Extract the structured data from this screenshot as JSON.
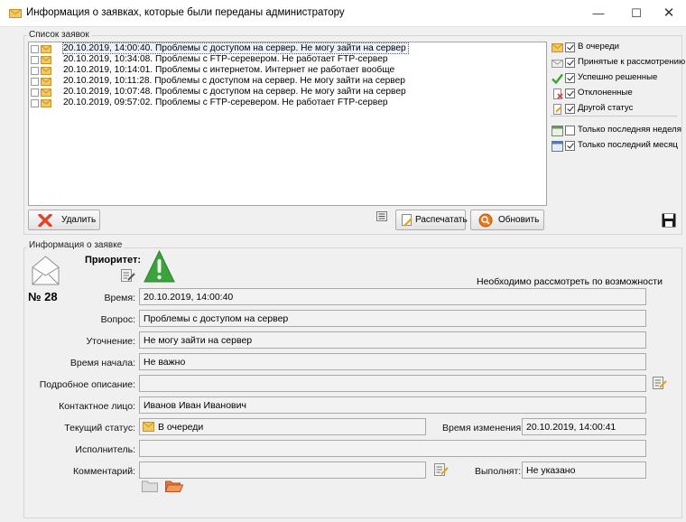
{
  "window": {
    "title": "Информация о заявках, которые были переданы администратору",
    "minimize_glyph": "—",
    "maximize_glyph": "☐",
    "close_glyph": "✕"
  },
  "list_group": {
    "title": "Список заявок",
    "requests": [
      {
        "text": "20.10.2019, 14:00:40. Проблемы с доступом на сервер. Не могу зайти на сервер",
        "checked": false,
        "selected": true
      },
      {
        "text": "20.10.2019, 10:34:08. Проблемы с FTP-серевером. Не работает FTP-сервер",
        "checked": false,
        "selected": false
      },
      {
        "text": "20.10.2019, 10:14:01. Проблемы с интернетом. Интернет не работает вообще",
        "checked": false,
        "selected": false
      },
      {
        "text": "20.10.2019, 10:11:28. Проблемы с доступом на сервер. Не могу зайти на сервер",
        "checked": false,
        "selected": false
      },
      {
        "text": "20.10.2019, 10:07:48. Проблемы с доступом на сервер. Не могу зайти на сервер",
        "checked": false,
        "selected": false
      },
      {
        "text": "20.10.2019, 09:57:02. Проблемы с FTP-серевером. Не работает FTP-сервер",
        "checked": false,
        "selected": false
      }
    ],
    "filters": [
      {
        "label": "В очереди",
        "checked": true,
        "icon": "envelope-icon"
      },
      {
        "label": "Принятые к рассмотрению",
        "checked": true,
        "icon": "envelope-open-icon"
      },
      {
        "label": "Успешно решенные",
        "checked": true,
        "icon": "checkmark-icon"
      },
      {
        "label": "Отклоненные",
        "checked": true,
        "icon": "rejected-doc-icon"
      },
      {
        "label": "Другой статус",
        "checked": true,
        "icon": "other-doc-icon"
      }
    ],
    "period_filters": [
      {
        "label": "Только последняя неделя",
        "checked": false,
        "icon": "calendar-week-icon"
      },
      {
        "label": "Только последний месяц",
        "checked": true,
        "icon": "calendar-month-icon"
      }
    ],
    "delete_label": "Удалить",
    "print_label": "Распечатать",
    "refresh_label": "Обновить"
  },
  "details_group": {
    "title": "Информация о заявке",
    "priority_label": "Приоритет:",
    "request_number": "№ 28",
    "priority_note": "Необходимо рассмотреть по возможности",
    "fields": {
      "time_label": "Время:",
      "time_value": "20.10.2019, 14:00:40",
      "question_label": "Вопрос:",
      "question_value": "Проблемы с доступом на сервер",
      "clarification_label": "Уточнение:",
      "clarification_value": "Не могу зайти на сервер",
      "start_label": "Время начала:",
      "start_value": "Не важно",
      "description_label": "Подробное описание:",
      "description_value": "",
      "contact_label": "Контактное лицо:",
      "contact_value": "Иванов Иван Иванович",
      "status_label": "Текущий статус:",
      "status_value": "В очереди",
      "changed_label": "Время изменения:",
      "changed_value": "20.10.2019, 14:00:41",
      "executor_label": "Исполнитель:",
      "executor_value": "",
      "comment_label": "Комментарий:",
      "comment_value": "",
      "performs_label": "Выполнят:",
      "performs_value": "Не указано"
    }
  },
  "colors": {
    "envelope": "#f0c060",
    "delete_x": "#e0442a",
    "refresh": "#e87a1e",
    "priority": "#3aa33a",
    "check": "#3aa33a"
  }
}
